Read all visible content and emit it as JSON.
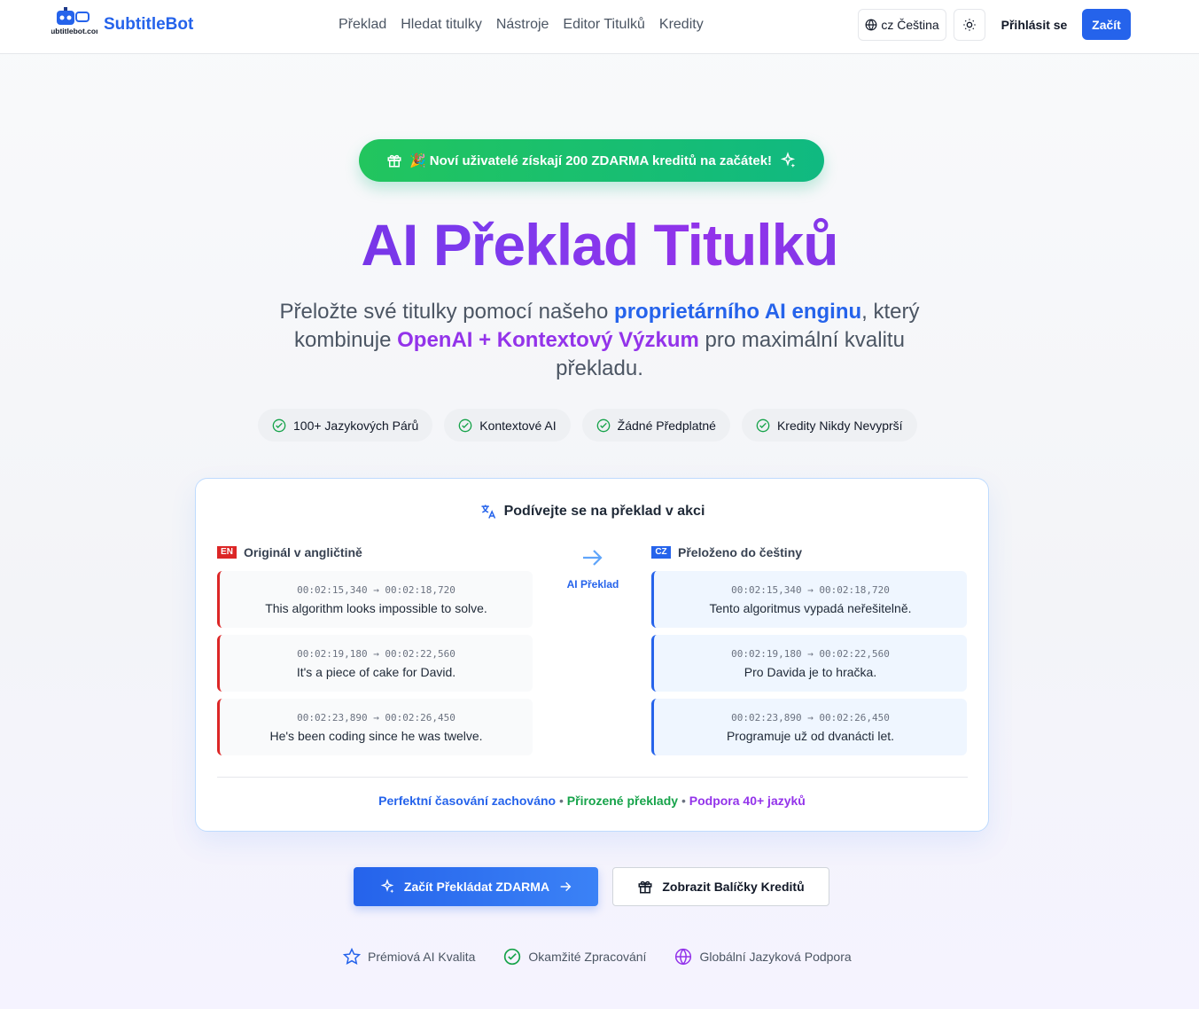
{
  "header": {
    "brand": "SubtitleBot",
    "logo_text": "subtitlebot.com",
    "nav": [
      "Překlad",
      "Hledat titulky",
      "Nástroje",
      "Editor Titulků",
      "Kredity"
    ],
    "language": "cz Čeština",
    "login": "Přihlásit se",
    "start": "Začít"
  },
  "promo": "🎉 Noví uživatelé získají 200 ZDARMA kreditů na začátek!",
  "hero": {
    "title": "AI Překlad Titulků",
    "subtitle_part1": "Přeložte své titulky pomocí našeho ",
    "subtitle_hl1": "proprietárního AI enginu",
    "subtitle_part2": ", který kombinuje ",
    "subtitle_hl2": "OpenAI + Kontextový Výzkum",
    "subtitle_part3": " pro maximální kvalitu překladu."
  },
  "chips": [
    "100+ Jazykových Párů",
    "Kontextové AI",
    "Žádné Předplatné",
    "Kredity Nikdy Nevyprší"
  ],
  "demo": {
    "title": "Podívejte se na překlad v akci",
    "left_flag": "EN",
    "left_head": "Originál v angličtině",
    "right_flag": "CZ",
    "right_head": "Přeloženo do češtiny",
    "arrow_label": "AI Překlad",
    "original": [
      {
        "ts": "00:02:15,340 → 00:02:18,720",
        "text": "This algorithm looks impossible to solve."
      },
      {
        "ts": "00:02:19,180 → 00:02:22,560",
        "text": "It's a piece of cake for David."
      },
      {
        "ts": "00:02:23,890 → 00:02:26,450",
        "text": "He's been coding since he was twelve."
      }
    ],
    "translated": [
      {
        "ts": "00:02:15,340 → 00:02:18,720",
        "text": "Tento algoritmus vypadá neřešitelně."
      },
      {
        "ts": "00:02:19,180 → 00:02:22,560",
        "text": "Pro Davida je to hračka."
      },
      {
        "ts": "00:02:23,890 → 00:02:26,450",
        "text": "Programuje už od dvanácti let."
      }
    ],
    "footer_1": "Perfektní časování zachováno",
    "footer_2": "Přirozené překlady",
    "footer_3": "Podpora 40+ jazyků",
    "footer_sep": "•"
  },
  "cta": {
    "primary": "Začít Překládat ZDARMA",
    "secondary": "Zobrazit Balíčky Kreditů"
  },
  "benefits": [
    "Prémiová AI Kvalita",
    "Okamžité Zpracování",
    "Globální Jazyková Podpora"
  ],
  "colors": {
    "brand": "#2563eb",
    "accent_purple": "#9333ea",
    "success": "#16a34a",
    "en_flag": "#dc2626",
    "cz_flag": "#2563eb"
  }
}
